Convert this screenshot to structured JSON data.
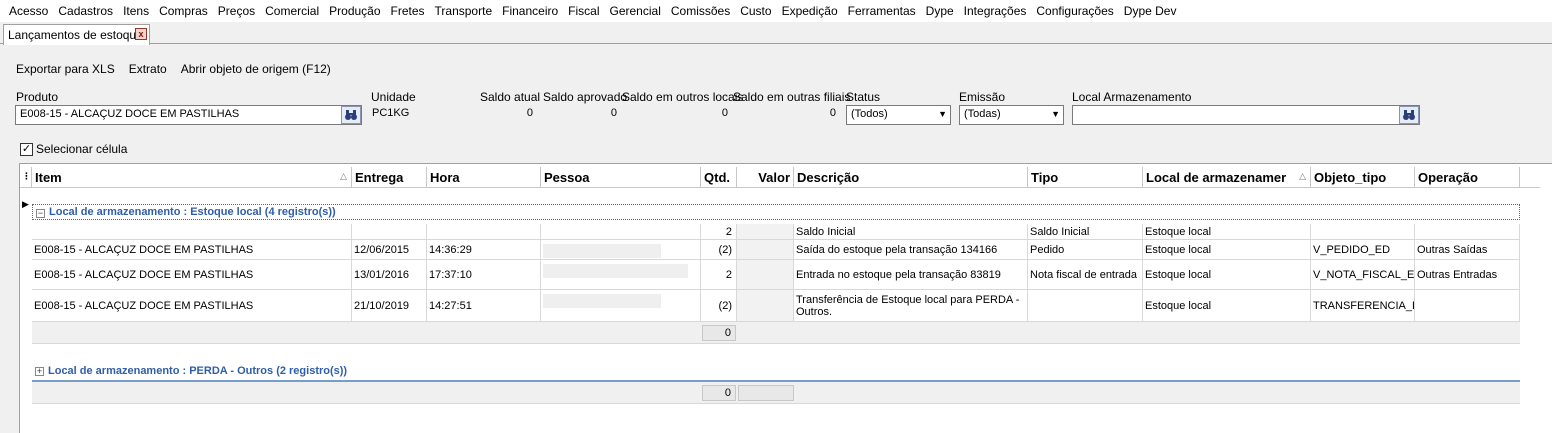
{
  "menu": [
    "Acesso",
    "Cadastros",
    "Itens",
    "Compras",
    "Preços",
    "Comercial",
    "Produção",
    "Fretes",
    "Transporte",
    "Financeiro",
    "Fiscal",
    "Gerencial",
    "Comissões",
    "Custo",
    "Expedição",
    "Ferramentas",
    "Dype",
    "Integrações",
    "Configurações",
    "Dype Dev"
  ],
  "tab": {
    "label": "Lançamentos de estoque",
    "close": "x"
  },
  "toolbar": {
    "export": "Exportar para XLS",
    "extrato": "Extrato",
    "abrir": "Abrir objeto de origem (F12)"
  },
  "filters": {
    "produto_label": "Produto",
    "produto_value": "E008-15 - ALCAÇUZ DOCE EM PASTILHAS",
    "unidade_label": "Unidade",
    "unidade_value": "PC1KG",
    "saldo_atual_label": "Saldo atual",
    "saldo_atual_value": "0",
    "saldo_aprovado_label": "Saldo aprovado",
    "saldo_aprovado_value": "0",
    "saldo_outros_locais_label": "Saldo em outros locais",
    "saldo_outros_locais_value": "0",
    "saldo_outras_filiais_label": "Saldo em outras filiais",
    "saldo_outras_filiais_value": "0",
    "status_label": "Status",
    "status_value": "(Todos)",
    "emissao_label": "Emissão",
    "emissao_value": "(Todas)",
    "local_label": "Local Armazenamento",
    "local_value": ""
  },
  "selecionar_celula": "Selecionar célula",
  "grid": {
    "columns": [
      "Item",
      "Entrega",
      "Hora",
      "Pessoa",
      "Qtd.",
      "Valor",
      "Descrição",
      "Tipo",
      "Local de armazenamer",
      "Objeto_tipo",
      "Operação"
    ],
    "group1": "Local de armazenamento : Estoque local (4 registro(s))",
    "group1_expander": "−",
    "rows": [
      {
        "item": "",
        "entrega": "",
        "hora": "",
        "pessoa": "",
        "qtd": "2",
        "valor": "",
        "descricao": "Saldo Inicial",
        "tipo": "Saldo Inicial",
        "local": "Estoque local",
        "objeto": "",
        "operacao": ""
      },
      {
        "item": "E008-15 - ALCAÇUZ DOCE EM PASTILHAS",
        "entrega": "12/06/2015",
        "hora": "14:36:29",
        "pessoa": "",
        "qtd": "(2)",
        "valor": "",
        "descricao": "Saída do estoque pela transação 134166",
        "tipo": "Pedido",
        "local": "Estoque local",
        "objeto": "V_PEDIDO_ED",
        "operacao": "Outras Saídas"
      },
      {
        "item": "E008-15 - ALCAÇUZ DOCE EM PASTILHAS",
        "entrega": "13/01/2016",
        "hora": "17:37:10",
        "pessoa": "",
        "qtd": "2",
        "valor": "",
        "descricao": "Entrada no estoque pela transação 83819",
        "tipo": "Nota fiscal de entrada",
        "local": "Estoque local",
        "objeto": "V_NOTA_FISCAL_ENTRADA_ED",
        "operacao": "Outras Entradas"
      },
      {
        "item": "E008-15 - ALCAÇUZ DOCE EM PASTILHAS",
        "entrega": "21/10/2019",
        "hora": "14:27:51",
        "pessoa": "",
        "qtd": "(2)",
        "valor": "",
        "descricao": "Transferência de Estoque local para PERDA - Outros.",
        "tipo": "",
        "local": "Estoque local",
        "objeto": "TRANSFERENCIA_ESTOQUE",
        "operacao": ""
      }
    ],
    "group1_sum": "0",
    "group2": "Local de armazenamento : PERDA - Outros (2 registro(s))",
    "group2_expander": "+",
    "total_sum": "0"
  }
}
